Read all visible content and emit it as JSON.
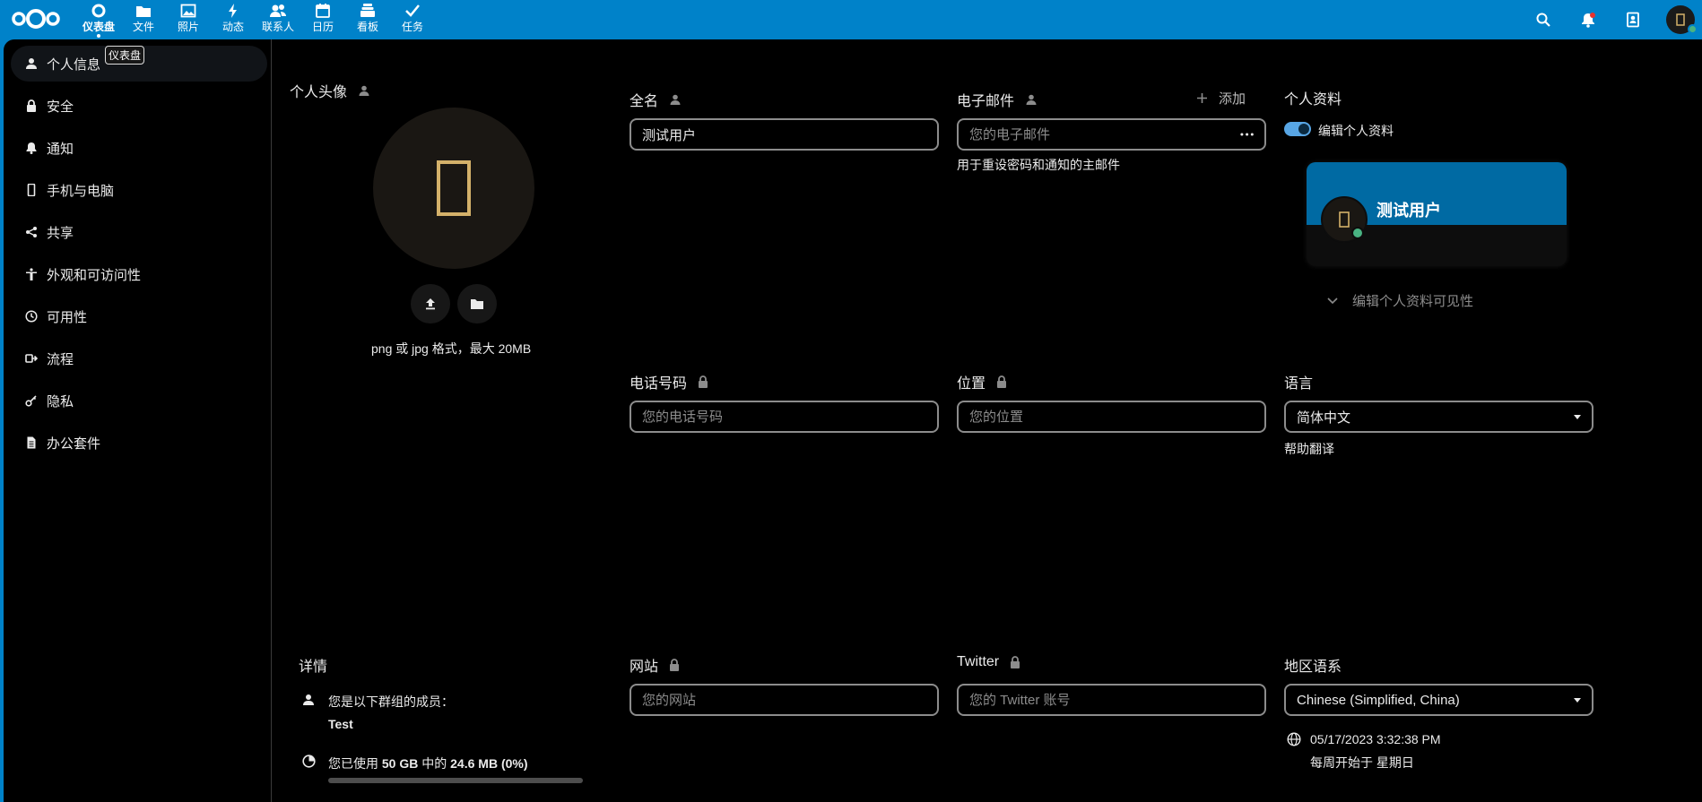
{
  "header": {
    "apps": [
      {
        "label": "仪表盘",
        "icon": "dashboard-icon",
        "active": true
      },
      {
        "label": "文件",
        "icon": "folder-icon"
      },
      {
        "label": "照片",
        "icon": "image-icon"
      },
      {
        "label": "动态",
        "icon": "lightning-icon"
      },
      {
        "label": "联系人",
        "icon": "contacts-icon"
      },
      {
        "label": "日历",
        "icon": "calendar-icon"
      },
      {
        "label": "看板",
        "icon": "deck-icon"
      },
      {
        "label": "任务",
        "icon": "checkmark-icon"
      }
    ],
    "tooltip": "仪表盘"
  },
  "sidebar": {
    "items": [
      {
        "label": "个人信息",
        "icon": "user-icon",
        "active": true
      },
      {
        "label": "安全",
        "icon": "lock-icon"
      },
      {
        "label": "通知",
        "icon": "bell-icon"
      },
      {
        "label": "手机与电脑",
        "icon": "phone-icon"
      },
      {
        "label": "共享",
        "icon": "share-icon"
      },
      {
        "label": "外观和可访问性",
        "icon": "accessibility-icon"
      },
      {
        "label": "可用性",
        "icon": "clock-icon"
      },
      {
        "label": "流程",
        "icon": "workflow-icon"
      },
      {
        "label": "隐私",
        "icon": "key-icon"
      },
      {
        "label": "办公套件",
        "icon": "document-icon"
      }
    ]
  },
  "main": {
    "avatar": {
      "label": "个人头像",
      "hint": "png 或 jpg 格式，最大 20MB"
    },
    "fullname": {
      "label": "全名",
      "value": "测试用户"
    },
    "email": {
      "label": "电子邮件",
      "add_label": "添加",
      "placeholder": "您的电子邮件",
      "hint": "用于重设密码和通知的主邮件"
    },
    "profile": {
      "label": "个人资料",
      "toggle_label": "编辑个人资料",
      "display_name": "测试用户",
      "visibility_label": "编辑个人资料可见性"
    },
    "phone": {
      "label": "电话号码",
      "placeholder": "您的电话号码"
    },
    "location": {
      "label": "位置",
      "placeholder": "您的位置"
    },
    "language": {
      "label": "语言",
      "value": "简体中文",
      "help_link": "帮助翻译"
    },
    "details": {
      "label": "详情",
      "groups_label": "您是以下群组的成员：",
      "group_name": "Test",
      "usage_prefix": "您已使用 ",
      "usage_used": "50 GB",
      "usage_mid": " 中的 ",
      "usage_amount": "24.6 MB",
      "usage_pct": " (0%)",
      "usage_fraction": 0.0
    },
    "website": {
      "label": "网站",
      "placeholder": "您的网站"
    },
    "twitter": {
      "label": "Twitter",
      "placeholder": "您的 Twitter 账号"
    },
    "locale": {
      "label": "地区语系",
      "value": "Chinese (Simplified, China)",
      "datetime": "05/17/2023 3:32:38 PM",
      "week_start": "每周开始于 星期日"
    }
  },
  "colors": {
    "header_bg": "#0082c9",
    "accent": "#58a6e5",
    "status_online": "#49b382"
  }
}
